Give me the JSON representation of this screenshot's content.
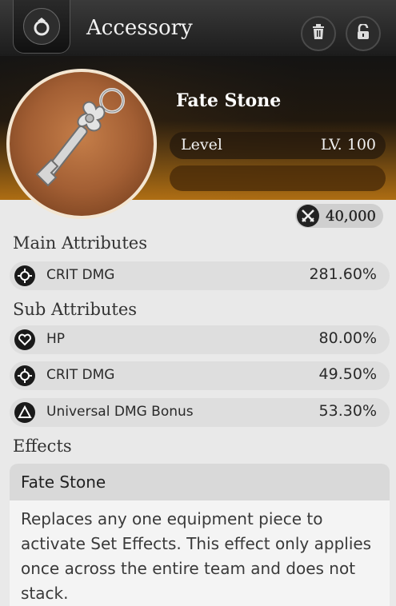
{
  "header": {
    "title": "Accessory",
    "category_icon": "ring-icon",
    "buttons": [
      {
        "name": "delete-button",
        "icon": "trash-icon"
      },
      {
        "name": "lock-button",
        "icon": "unlock-icon"
      }
    ]
  },
  "item": {
    "name": "Fate Stone",
    "image": "key-icon",
    "level_label": "Level",
    "level_value": "LV. 100",
    "power_icon": "crossed-swords-icon",
    "power_value": "40,000"
  },
  "main_attributes": {
    "heading": "Main Attributes",
    "rows": [
      {
        "icon": "crit-target-icon",
        "name": "CRIT DMG",
        "value": "281.60%"
      }
    ]
  },
  "sub_attributes": {
    "heading": "Sub Attributes",
    "rows": [
      {
        "icon": "heart-icon",
        "name": "HP",
        "value": "80.00%"
      },
      {
        "icon": "crit-target-icon",
        "name": "CRIT DMG",
        "value": "49.50%"
      },
      {
        "icon": "triangle-icon",
        "name": "Universal DMG Bonus",
        "value": "53.30%"
      }
    ]
  },
  "effects": {
    "heading": "Effects",
    "name": "Fate Stone",
    "description": "Replaces any one equipment piece to activate Set Effects. This effect only applies once across the entire team and does not stack."
  },
  "colors": {
    "accent_orange": "#b07214",
    "header_dark": "#1c1c1c",
    "row_bg": "#dedede"
  }
}
